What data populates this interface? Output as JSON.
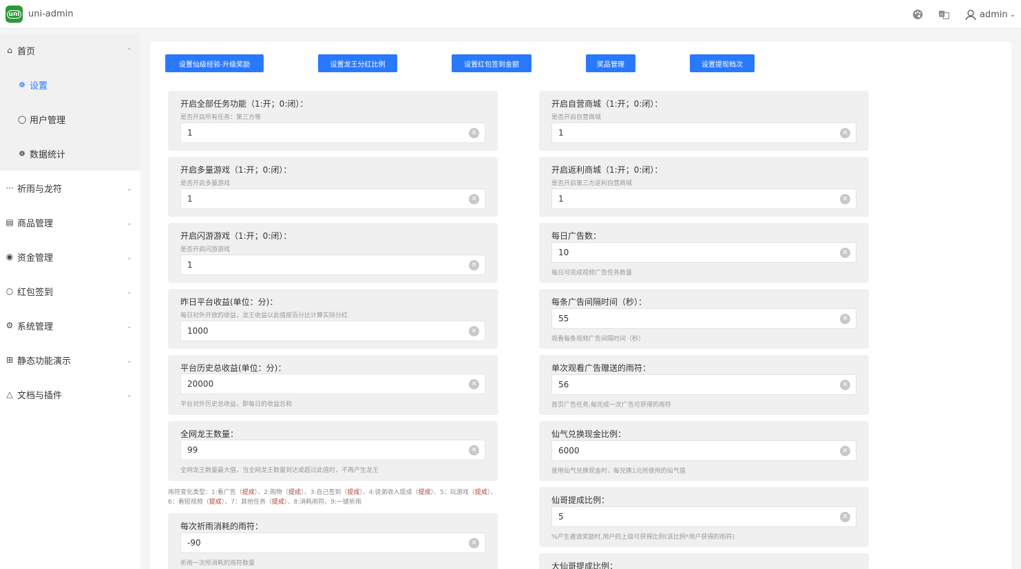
{
  "app": {
    "title": "uni-admin",
    "logo_text": "uni"
  },
  "header": {
    "user": "admin"
  },
  "sidebar": {
    "items": [
      {
        "label": "首页",
        "icon": "home-icon",
        "open": true
      },
      {
        "label": "设置",
        "icon": "gear-icon",
        "sub": true,
        "active": true
      },
      {
        "label": "用户管理",
        "icon": "user-icon",
        "sub": true
      },
      {
        "label": "数据统计",
        "icon": "gear-icon",
        "sub": true
      },
      {
        "label": "祈雨与龙符",
        "icon": "more-icon"
      },
      {
        "label": "商品管理",
        "icon": "goods-icon"
      },
      {
        "label": "资金管理",
        "icon": "eye-icon"
      },
      {
        "label": "红包签到",
        "icon": "circle-icon"
      },
      {
        "label": "系统管理",
        "icon": "settings-icon"
      },
      {
        "label": "静态功能演示",
        "icon": "grid-icon"
      },
      {
        "label": "文档与插件",
        "icon": "plugin-icon"
      }
    ]
  },
  "toolbar": {
    "buttons": [
      "设置仙级经验-升级奖励",
      "设置龙王分红比例",
      "设置红包签到金额",
      "奖品管理",
      "设置提现档次"
    ]
  },
  "left_cards": [
    {
      "title": "开启全部任务功能（1:开；0:闭）：",
      "desc": "是否开启所有任务：第三方等",
      "value": "1"
    },
    {
      "title": "开启多量游戏（1:开；0:闭）：",
      "desc": "是否开启多量游戏",
      "value": "1"
    },
    {
      "title": "开启闪游游戏（1:开；0:闭）：",
      "desc": "是否开启闪游游戏",
      "value": "1"
    },
    {
      "title": "昨日平台收益(单位：分)：",
      "desc": "每日对外开放的收益，龙王收益以此值按百分比计算实际分红",
      "value": "1000"
    },
    {
      "title": "平台历史总收益(单位：分)：",
      "desc": "平台对外历史总收益，即每日的收益总和",
      "value": "20000"
    },
    {
      "title": "全网龙王数量：",
      "desc": "全网龙王数量最大值，当全网龙王数量到达或超过此值时，不再产生龙王",
      "value": "99"
    },
    {
      "title": "每次祈雨消耗的雨符：",
      "desc": "祈雨一次所消耗的雨符数量",
      "value": "-90"
    }
  ],
  "right_cards": [
    {
      "title": "开启自营商城（1:开；0:闭）：",
      "desc": "是否开启自营商城",
      "value": "1"
    },
    {
      "title": "开启返利商城（1:开；0:闭）：",
      "desc": "是否开启第三方返利自营商城",
      "value": "1"
    },
    {
      "title": "每日广告数：",
      "desc": "每日可完成视频广告任务数量",
      "value": "10"
    },
    {
      "title": "每条广告间隔时间（秒）：",
      "desc": "观看每条视频广告间隔时间（秒）",
      "value": "55"
    },
    {
      "title": "单次观看广告赠送的雨符：",
      "desc": "首页广告任务,每完成一次广告可获得的雨符",
      "value": "56"
    },
    {
      "title": "仙气兑换现金比例：",
      "desc": "使用仙气兑换现金时，每兑换1元所使用的仙气值",
      "value": "6000"
    },
    {
      "title": "仙哥提成比例：",
      "desc": "%产生邀请奖励时,用户的上级可获得比例(该比例*用户获得的雨符)",
      "value": "5"
    },
    {
      "title": "大仙哥提成比例：",
      "desc": "",
      "value": ""
    }
  ],
  "note": {
    "parts": [
      "雨符变化类型：1:看广告（",
      "提成",
      "）、2:购物（",
      "提成",
      "）、3:自己签到（",
      "提成",
      "）、4:徒弟收入提成（",
      "提成",
      "）、5：玩游戏（",
      "提成",
      "）、6：看短视频（",
      "提成",
      "）、7：其他任务（",
      "提成",
      "）、8:消耗雨符、9:一键祈雨"
    ]
  },
  "colors": {
    "primary": "#2979ff",
    "logo": "#2b9939",
    "highlight": "#b03a2e"
  }
}
